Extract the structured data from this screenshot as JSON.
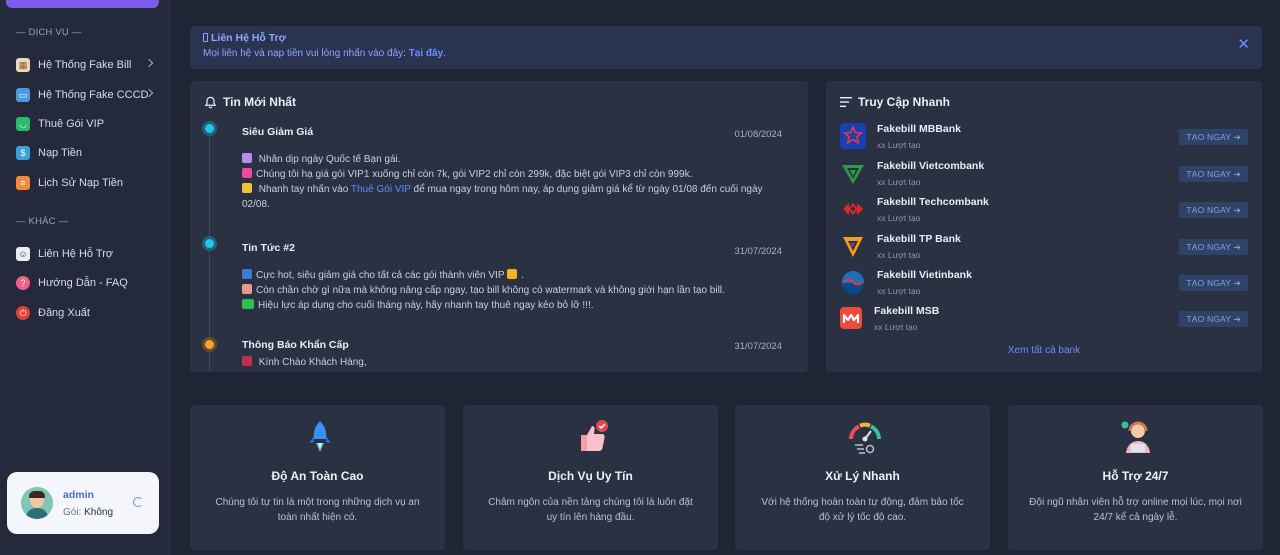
{
  "sidebar": {
    "section_service": "— DỊCH VỤ —",
    "section_other": "— KHÁC —",
    "items": [
      {
        "label": "Hệ Thống Fake Bill",
        "icon": "bank-building-icon"
      },
      {
        "label": "Hệ Thống Fake CCCD",
        "icon": "id-card-icon"
      },
      {
        "label": "Thuê Gói VIP",
        "icon": "shopping-basket-icon"
      },
      {
        "label": "Nạp Tiền",
        "icon": "money-deposit-icon"
      },
      {
        "label": "Lịch Sử Nạp Tiền",
        "icon": "history-icon"
      },
      {
        "label": "Liên Hệ Hỗ Trợ",
        "icon": "support-person-icon"
      },
      {
        "label": "Hướng Dẫn - FAQ",
        "icon": "question-icon"
      },
      {
        "label": "Đăng Xuất",
        "icon": "power-icon"
      }
    ],
    "user": {
      "name": "admin",
      "package_label": "Gói:",
      "package_value": "Không"
    }
  },
  "alert": {
    "title": "Liên Hệ Hỗ Trợ",
    "text": "Mọi liên hệ và nạp tiền vui lòng nhấn vào đây:",
    "link": "Tại đây",
    "close": "✕"
  },
  "news": {
    "title": "Tin Mới Nhất",
    "items": [
      {
        "title": "Siêu Giảm Giá",
        "date": "01/08/2024",
        "lines": [
          "Nhân dịp ngày Quốc tế Bạn gái.",
          "Chúng tôi hạ giá gói VIP1 xuống chỉ còn 7k, gói VIP2 chỉ còn 299k, đặc biệt gói VIP3 chỉ còn 999k.",
          "Nhanh tay nhấn vào",
          "Thuê Gói VIP",
          "để mua ngay trong hôm nay, áp dụng giảm giá kể từ ngày 01/08 đến cuối ngày",
          "02/08."
        ]
      },
      {
        "title": "Tin Tức #2",
        "date": "31/07/2024",
        "lines": [
          "Cực hot, siêu giảm giá cho tất cả các gói thành viên VIP",
          "Còn chần chờ gì nữa mà không nâng cấp ngay, tạo bill không có watermark và không giới hạn lần tạo bill.",
          "Hiệu lực áp dụng cho cuối tháng này, hãy nhanh tay thuê ngay kẻo bỏ lỡ !!!."
        ]
      },
      {
        "title": "Thông Báo Khẩn Cấp",
        "date": "31/07/2024",
        "lines": [
          "Kính Chào Khách Hàng,"
        ]
      }
    ],
    "dot_colors": [
      "#1ec8e6",
      "#1ec8e6",
      "#f2a33a"
    ]
  },
  "quick": {
    "title": "Truy Cập Nhanh",
    "banks": [
      {
        "name": "Fakebill MBBank",
        "sub": "xx Lượt tạo",
        "button": "TẠO NGAY ➔",
        "logo": "mbbank-logo-icon"
      },
      {
        "name": "Fakebill Vietcombank",
        "sub": "xx Lượt tạo",
        "button": "TẠO NGAY ➔",
        "logo": "vietcombank-logo-icon"
      },
      {
        "name": "Fakebill Techcombank",
        "sub": "xx Lượt tạo",
        "button": "TẠO NGAY ➔",
        "logo": "techcombank-logo-icon"
      },
      {
        "name": "Fakebill TP Bank",
        "sub": "xx Lượt tạo",
        "button": "TẠO NGAY ➔",
        "logo": "tpbank-logo-icon"
      },
      {
        "name": "Fakebill Vietinbank",
        "sub": "xx Lượt tạo",
        "button": "TẠO NGAY ➔",
        "logo": "vietinbank-logo-icon"
      },
      {
        "name": "Fakebill MSB",
        "sub": "xx Lượt tạo",
        "button": "TẠO NGAY ➔",
        "logo": "msb-logo-icon"
      }
    ],
    "see_all": "Xem tất cả bank"
  },
  "features": [
    {
      "title": "Độ An Toàn Cao",
      "desc": "Chúng tôi tự tin là một trong những dịch vụ an toàn nhất hiện có.",
      "icon": "rocket-icon"
    },
    {
      "title": "Dịch Vụ Uy Tín",
      "desc": "Châm ngôn của nền tảng chúng tôi là luôn đặt uy tín lên hàng đầu.",
      "icon": "thumbs-up-icon"
    },
    {
      "title": "Xử Lý Nhanh",
      "desc": "Với hệ thống hoàn toàn tự động, đảm bảo tốc độ xử lý tốc độ cao.",
      "icon": "speedometer-icon"
    },
    {
      "title": "Hỗ Trợ 24/7",
      "desc": "Đội ngũ nhân viên hỗ trợ online mọi lúc, mọi nơi 24/7 kể cả ngày lễ.",
      "icon": "support-agent-icon"
    }
  ],
  "colors": {
    "accent": "#6d8cff",
    "sidebar_bg": "#242a3b",
    "card_bg": "#2a3142",
    "page_bg": "#1f2535"
  }
}
